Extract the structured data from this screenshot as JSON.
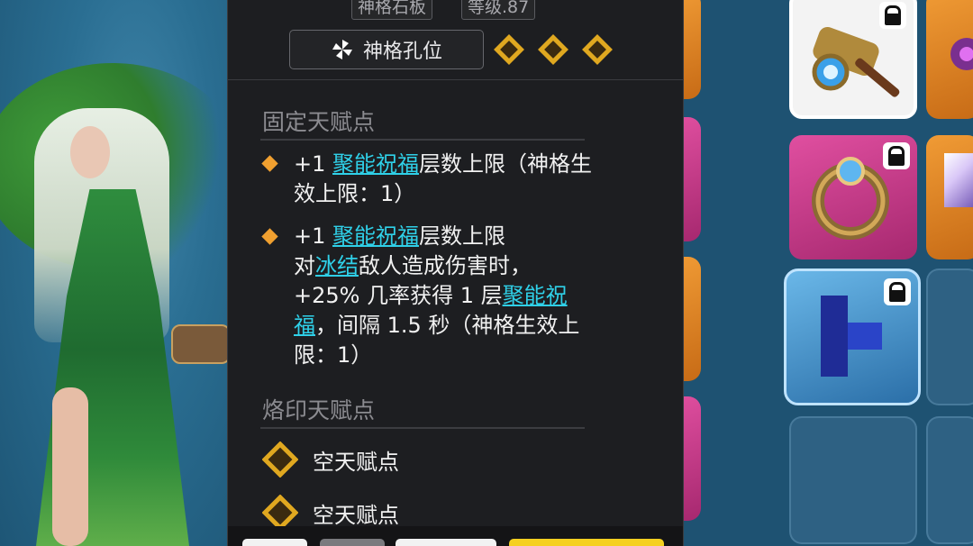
{
  "tooltip": {
    "top_tags": [
      "神格石板",
      "等级.87"
    ],
    "slot_button_label": "神格孔位",
    "gem_count": 3,
    "fixed_section_title": "固定天赋点",
    "fixed_entries": [
      {
        "prefix": "+1 ",
        "link": "聚能祝福",
        "line1_rest": "层数上限（神格生",
        "line2": "效上限：1）"
      },
      {
        "prefix": "+1 ",
        "link": "聚能祝福",
        "line1_rest": "层数上限",
        "line2_pre": "对",
        "line2_link": "冰结",
        "line2_rest": "敌人造成伤害时，",
        "line3_pre": "+25% 几率获得 1 层",
        "line3_link": "聚能祝",
        "line4_link": "福",
        "line4_rest": "，间隔 1.5 秒（神格生效上",
        "line5": "限：1）"
      }
    ],
    "imprint_section_title": "烙印天赋点",
    "empty_slots": [
      "空天赋点",
      "空天赋点"
    ]
  },
  "colors": {
    "panel_bg": "#1d1e21",
    "link": "#2fd0e8",
    "bullet": "#f0a030",
    "gem_gold": "#e0a820",
    "slot_orange": "#f09b35",
    "slot_pink": "#e04fa0"
  },
  "icons": [
    "pinwheel-icon",
    "diamond-gem-icon",
    "lock-icon",
    "hammer-icon",
    "ring-icon",
    "blue-glyph-icon"
  ]
}
